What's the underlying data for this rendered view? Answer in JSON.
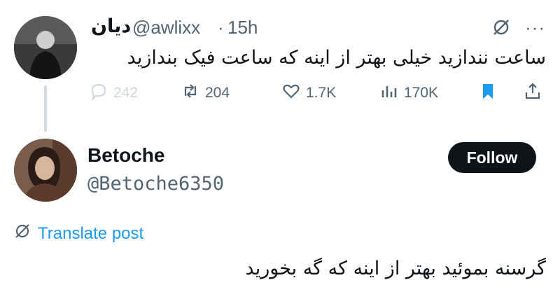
{
  "original_post": {
    "author_name": "دیان",
    "handle": "@awlixx",
    "separator": "·",
    "time": "15h",
    "text": "ساعت نندازید خیلی بهتر از اینه که ساعت فیک بندازید",
    "actions": {
      "replies": "242",
      "reposts": "204",
      "likes": "1.7K",
      "views": "170K"
    },
    "more_label": "···"
  },
  "reply_post": {
    "author_name": "Betoche",
    "handle": "@Betoche6350",
    "follow_label": "Follow",
    "translate_label": "Translate post",
    "text": "گرسنه بموئید بهتر از اینه که گه بخورید"
  },
  "colors": {
    "accent": "#1d9bf0",
    "muted": "#536471",
    "text": "#0f1419",
    "reply_disabled": "#cfd9de"
  }
}
